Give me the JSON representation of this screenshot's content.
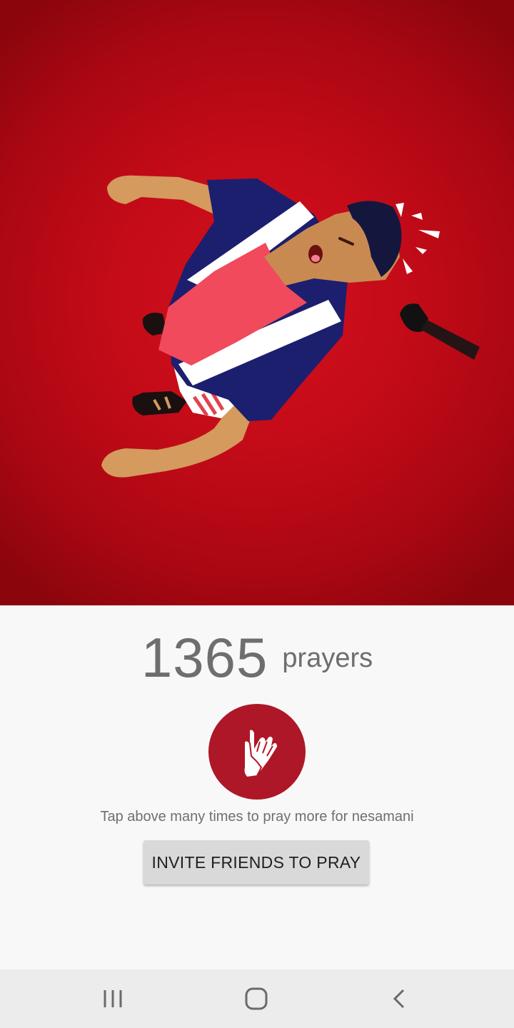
{
  "counter": {
    "count": "1365",
    "unit": "prayers"
  },
  "pray_button": {
    "icon": "praying-hands-icon",
    "color": "#ae1727"
  },
  "hint_text": "Tap above many times to pray more for nesamani",
  "invite_button": {
    "label": "INVITE FRIENDS TO PRAY"
  },
  "hero": {
    "background_color": "#c40b18",
    "illustration": "falling-man-hit-by-hammer"
  },
  "navbar": {
    "recent": "recent-apps-icon",
    "home": "home-icon",
    "back": "back-icon"
  }
}
